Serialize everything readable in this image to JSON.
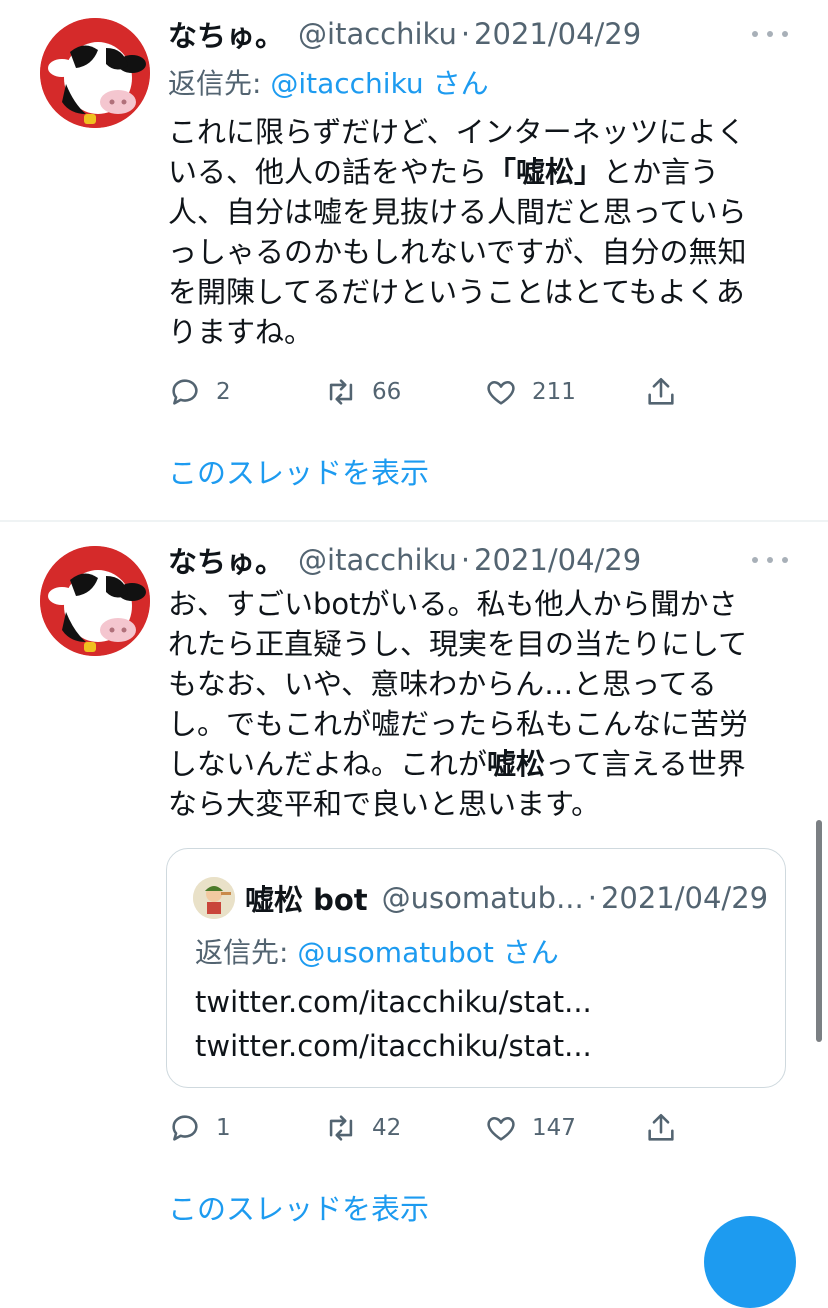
{
  "tweets": [
    {
      "name": "なちゅ。",
      "handle": "@itacchiku",
      "sep": "·",
      "date": "2021/04/29",
      "reply_prefix": "返信先: ",
      "reply_handle": "@itacchiku",
      "reply_suffix": " さん",
      "body": [
        {
          "t": "これに限らずだけど、インターネッツによく"
        },
        {
          "t": "いる、他人の話をやたら"
        },
        {
          "b": "「嘘松」"
        },
        {
          "t": "とか言う"
        },
        {
          "t": "人、自分は嘘を見抜ける人間だと思っていら"
        },
        {
          "t": "っしゃるのかもしれないですが、自分の無知"
        },
        {
          "t": "を開陳してるだけということはとてもよくあ"
        },
        {
          "t": "りますね。"
        }
      ],
      "replies": "2",
      "retweets": "66",
      "likes": "211",
      "thread_link": "このスレッドを表示"
    },
    {
      "name": "なちゅ。",
      "handle": "@itacchiku",
      "sep": "·",
      "date": "2021/04/29",
      "body": [
        {
          "t": "お、すごいbotがいる。私も他人から聞かさ"
        },
        {
          "t": "れたら正直疑うし、現実を目の当たりにして"
        },
        {
          "t": "もなお、いや、意味わからん…と思ってる"
        },
        {
          "t": "し。でもこれが嘘だったら私もこんなに苦労"
        },
        {
          "t": "しないんだよね。これが"
        },
        {
          "b": "嘘松"
        },
        {
          "t": "って言える世界"
        },
        {
          "t": "なら大変平和で良いと思います。"
        }
      ],
      "quote": {
        "name": "嘘松 bot",
        "handle": "@usomatub...",
        "sep": "·",
        "date": "2021/04/29",
        "reply_prefix": "返信先: ",
        "reply_handle": "@usomatubot",
        "reply_suffix": " さん",
        "links": [
          "twitter.com/itacchiku/stat...",
          "twitter.com/itacchiku/stat..."
        ]
      },
      "replies": "1",
      "retweets": "42",
      "likes": "147",
      "thread_link": "このスレッドを表示"
    }
  ],
  "icons": {
    "more": "more-dots-icon",
    "reply": "reply-icon",
    "retweet": "retweet-icon",
    "like": "heart-icon",
    "share": "share-icon"
  },
  "colors": {
    "link": "#1d9bf0",
    "muted": "#536471",
    "text": "#0f1419",
    "avatar_bg": "#d52a2a"
  }
}
